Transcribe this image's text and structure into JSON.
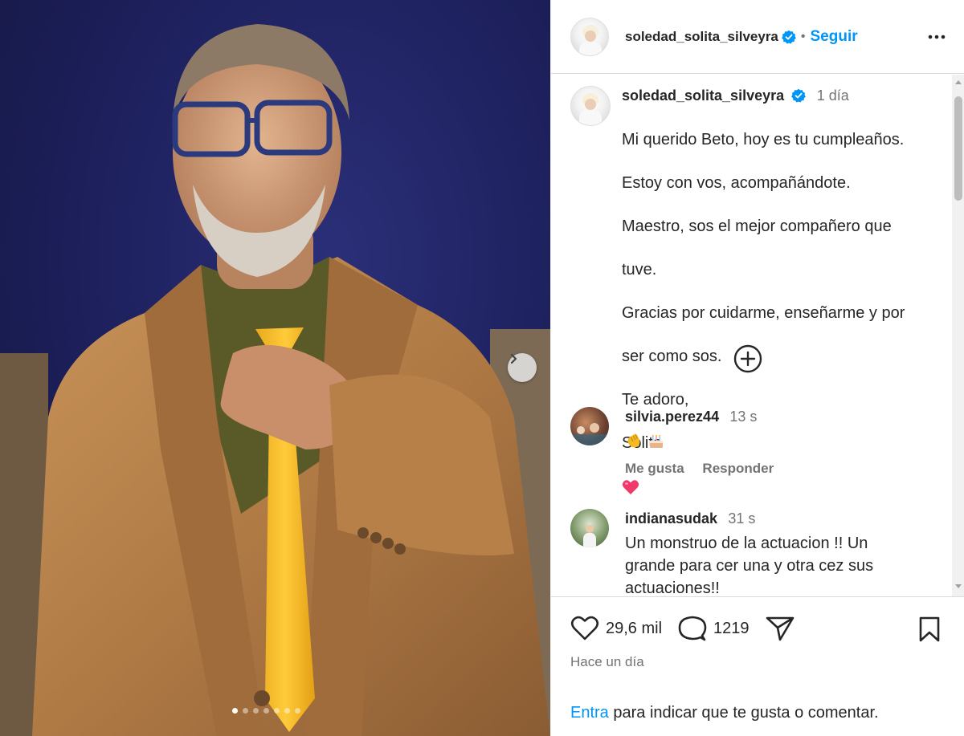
{
  "post": {
    "username": "soledad_solita_silveyra",
    "follow_label": "Seguir",
    "separator": "•",
    "time": "1 día",
    "caption_lines": [
      "Mi querido Beto, hoy es tu cumpleaños.",
      "Estoy con vos, acompañándote.",
      "Maestro, sos el mejor compañero que",
      "tuve.",
      "Gracias por cuidarme, enseñarme y por",
      "ser como sos.",
      "Te adoro,",
      "Solita"
    ],
    "caption_emoji": "heart-icon",
    "carousel": {
      "total_slides": 7,
      "active_slide": 1
    }
  },
  "comments": [
    {
      "username": "silvia.perez44",
      "time": "13 s",
      "emojis": [
        "clapping-hands-icon",
        "birthday-cake-icon"
      ],
      "like_label": "Me gusta",
      "reply_label": "Responder"
    },
    {
      "username": "indianasudak",
      "time": "31 s",
      "text_lines": [
        "Un monstruo de la actuacion !! Un",
        "grande para cer una y otra cez sus",
        "actuaciones!!"
      ]
    }
  ],
  "actions": {
    "likes": "29,6 mil",
    "comments_count": "1219",
    "posted_ago": "Hace un día",
    "login_link": "Entra",
    "login_rest": " para indicar que te gusta o comentar."
  },
  "colors": {
    "accent": "#0095f6",
    "text": "#262626",
    "muted": "#737373",
    "verified": "#0095f6"
  }
}
